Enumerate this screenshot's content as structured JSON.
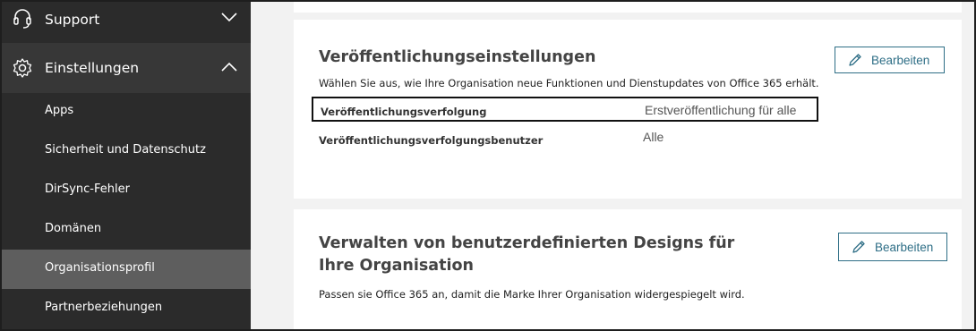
{
  "sidebar": {
    "support_label": "Support",
    "settings_label": "Einstellungen",
    "items": [
      {
        "label": "Apps"
      },
      {
        "label": "Sicherheit und Datenschutz"
      },
      {
        "label": "DirSync-Fehler"
      },
      {
        "label": "Domänen"
      },
      {
        "label": "Organisationsprofil",
        "selected": true
      },
      {
        "label": "Partnerbeziehungen"
      }
    ]
  },
  "release_card": {
    "title": "Veröffentlichungseinstellungen",
    "description": "Wählen Sie aus, wie Ihre Organisation neue Funktionen und Dienstupdates von Office 365 erhält.",
    "edit_label": "Bearbeiten",
    "rows": [
      {
        "name": "Veröffentlichungsverfolgung",
        "value": "Erstveröffentlichung für alle"
      },
      {
        "name": "Veröffentlichungsverfolgungsbenutzer",
        "value": "Alle"
      }
    ]
  },
  "themes_card": {
    "title_line1": "Verwalten von benutzerdefinierten Designs für",
    "title_line2": "Ihre Organisation",
    "description": "Passen sie Office 365 an, damit die Marke Ihrer Organisation widergespiegelt wird.",
    "edit_label": "Bearbeiten"
  },
  "colors": {
    "sidebar_bg": "#2b2b2b",
    "selected_bg": "#5e5e5e",
    "accent": "#2e6e86"
  },
  "icons": [
    "headset-icon",
    "chevron-down-icon",
    "gear-icon",
    "chevron-up-icon",
    "pencil-icon"
  ]
}
